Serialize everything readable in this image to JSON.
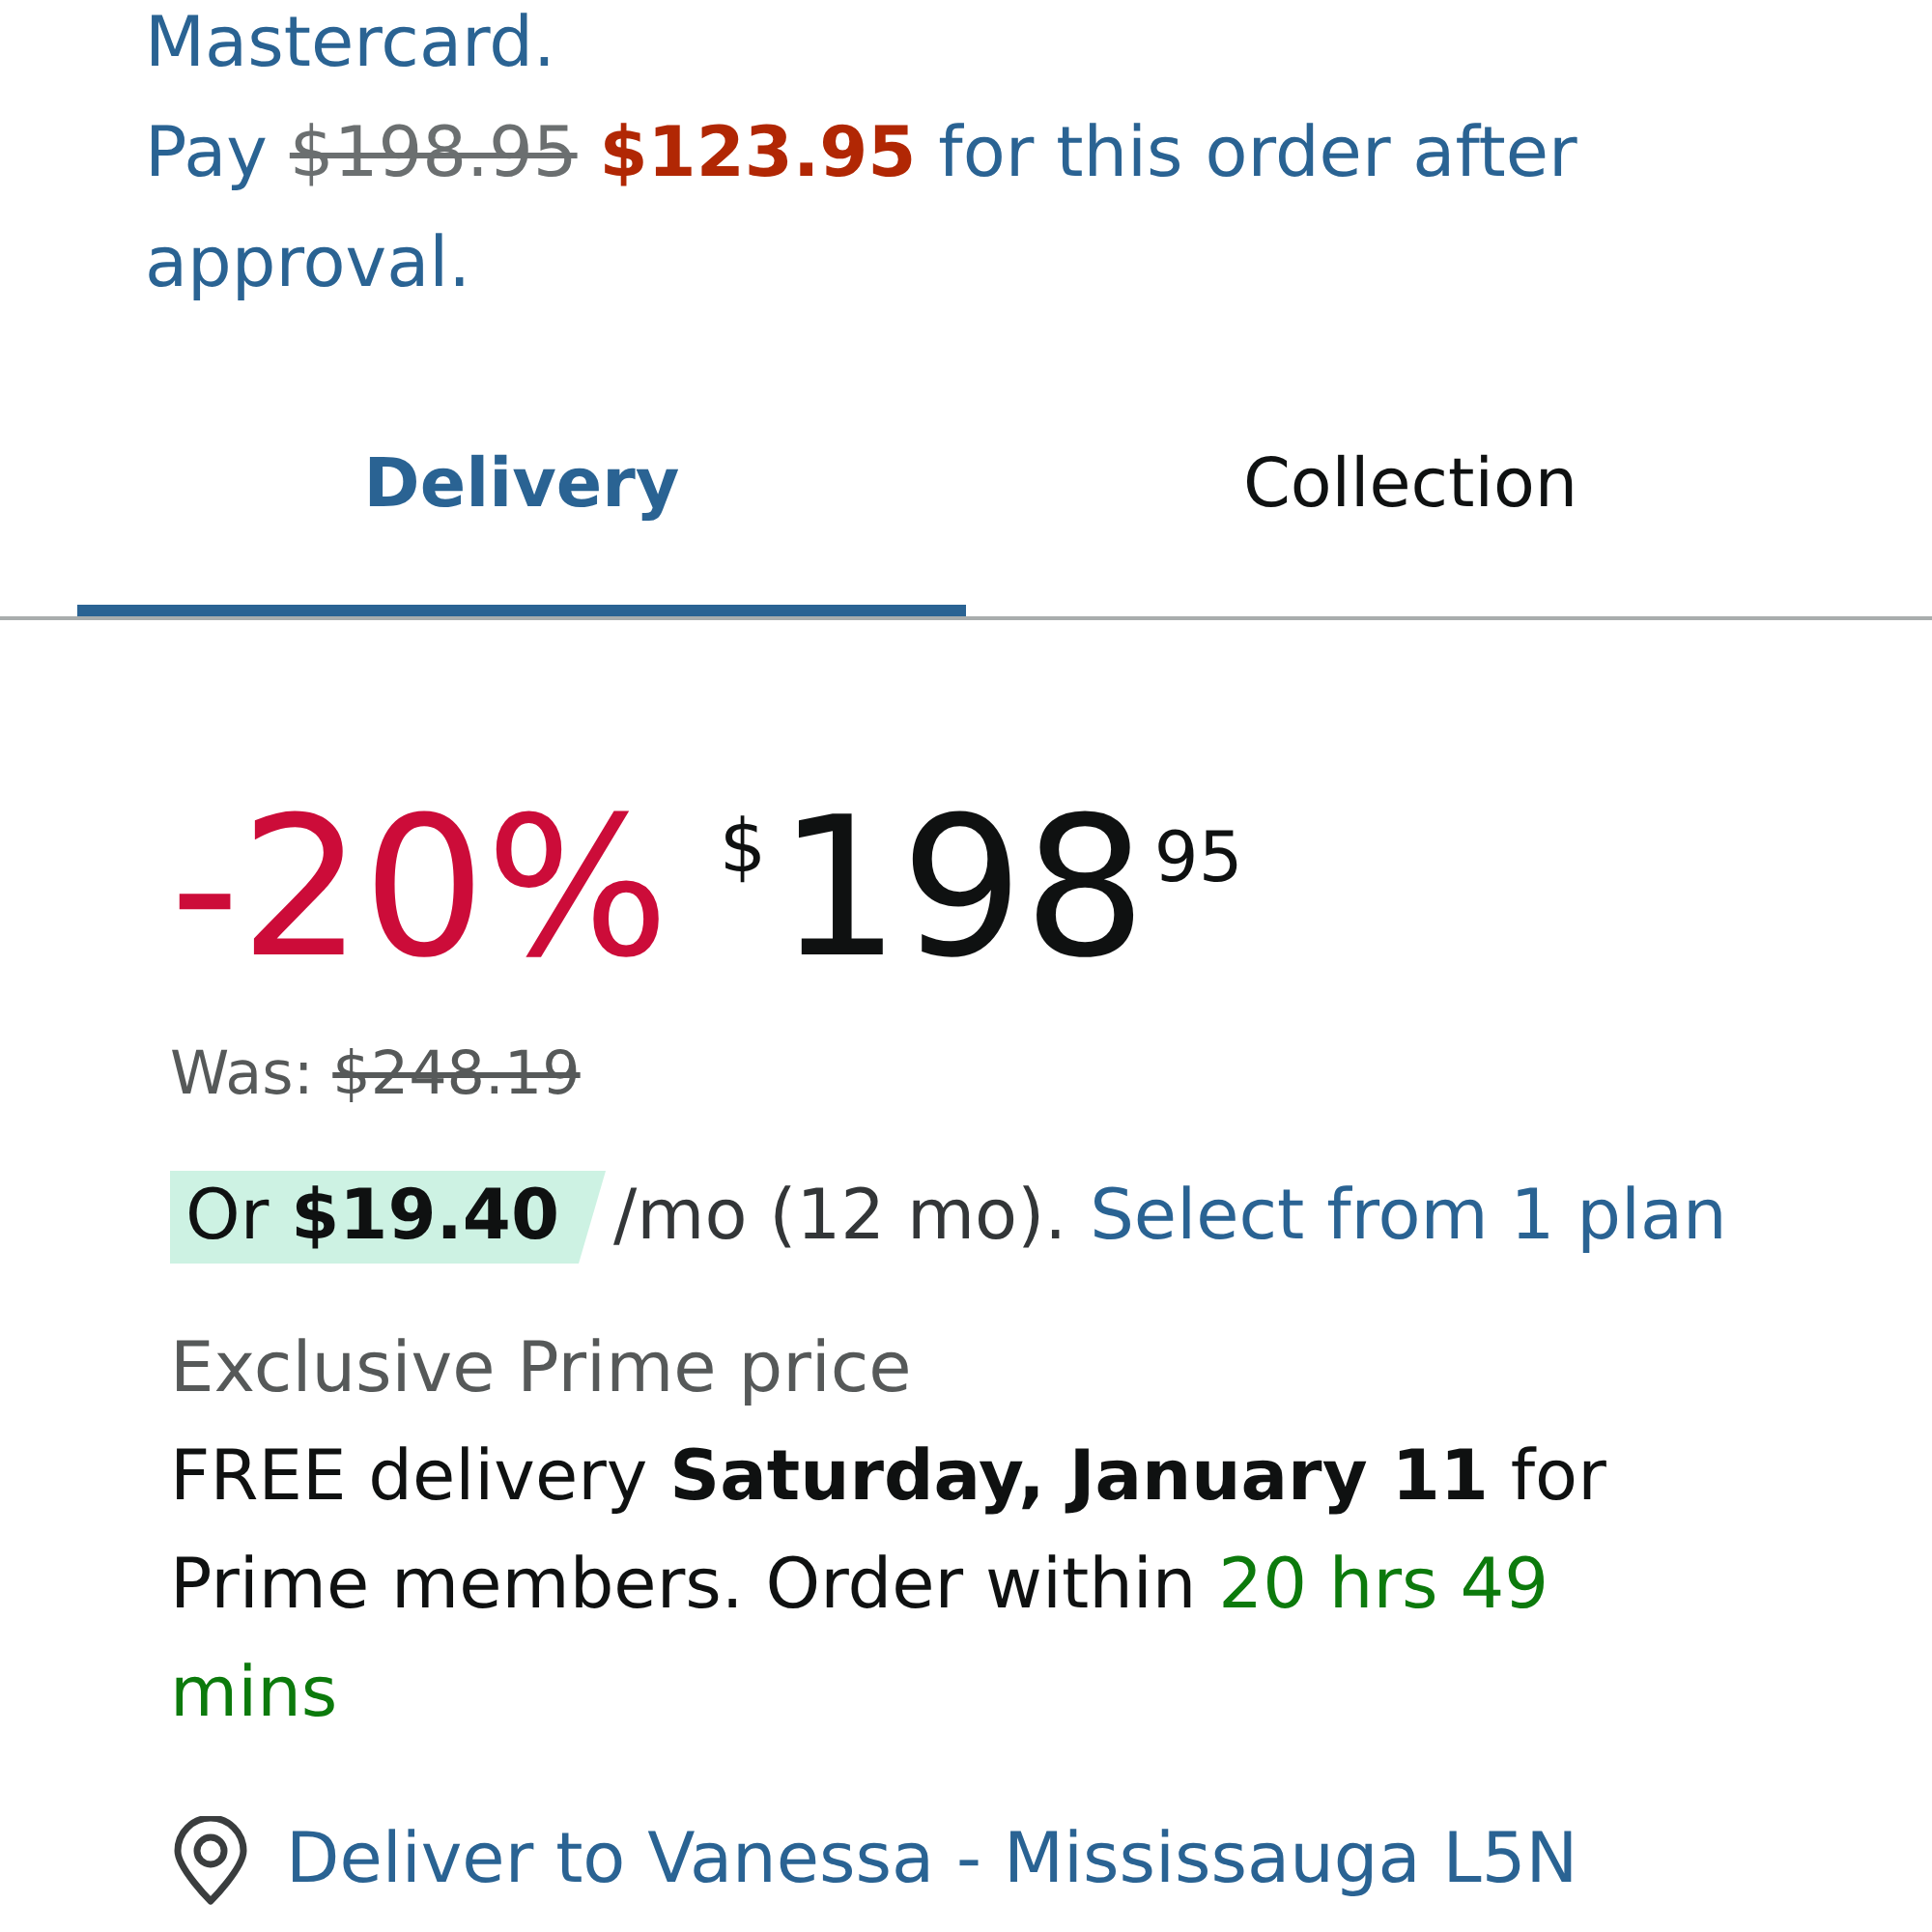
{
  "offer": {
    "text_start": "Mastercard.",
    "lead": "Pay",
    "old_price": "$198.95",
    "new_price": "$123.95",
    "text_end": "for this order after approval."
  },
  "tabs": [
    {
      "label": "Delivery",
      "selected": true
    },
    {
      "label": "Collection",
      "selected": false
    }
  ],
  "price": {
    "discount": "-20%",
    "currency": "$",
    "whole": "198",
    "fraction": "95"
  },
  "was_price": {
    "label": "Was:",
    "amount": "$248.19"
  },
  "installment": {
    "amount": "Or **$19.40**",
    "term": "/mo (12 mo).",
    "link": "Select from 1 plan"
  },
  "prime_note": "Exclusive Prime price",
  "delivery_message": {
    "text": "FREE delivery **Saturday, January 11** for Prime members. Order within",
    "countdown": "20 hrs 49 mins"
  },
  "deliver_to": "Deliver to Vanessa - Mississauga L5N"
}
